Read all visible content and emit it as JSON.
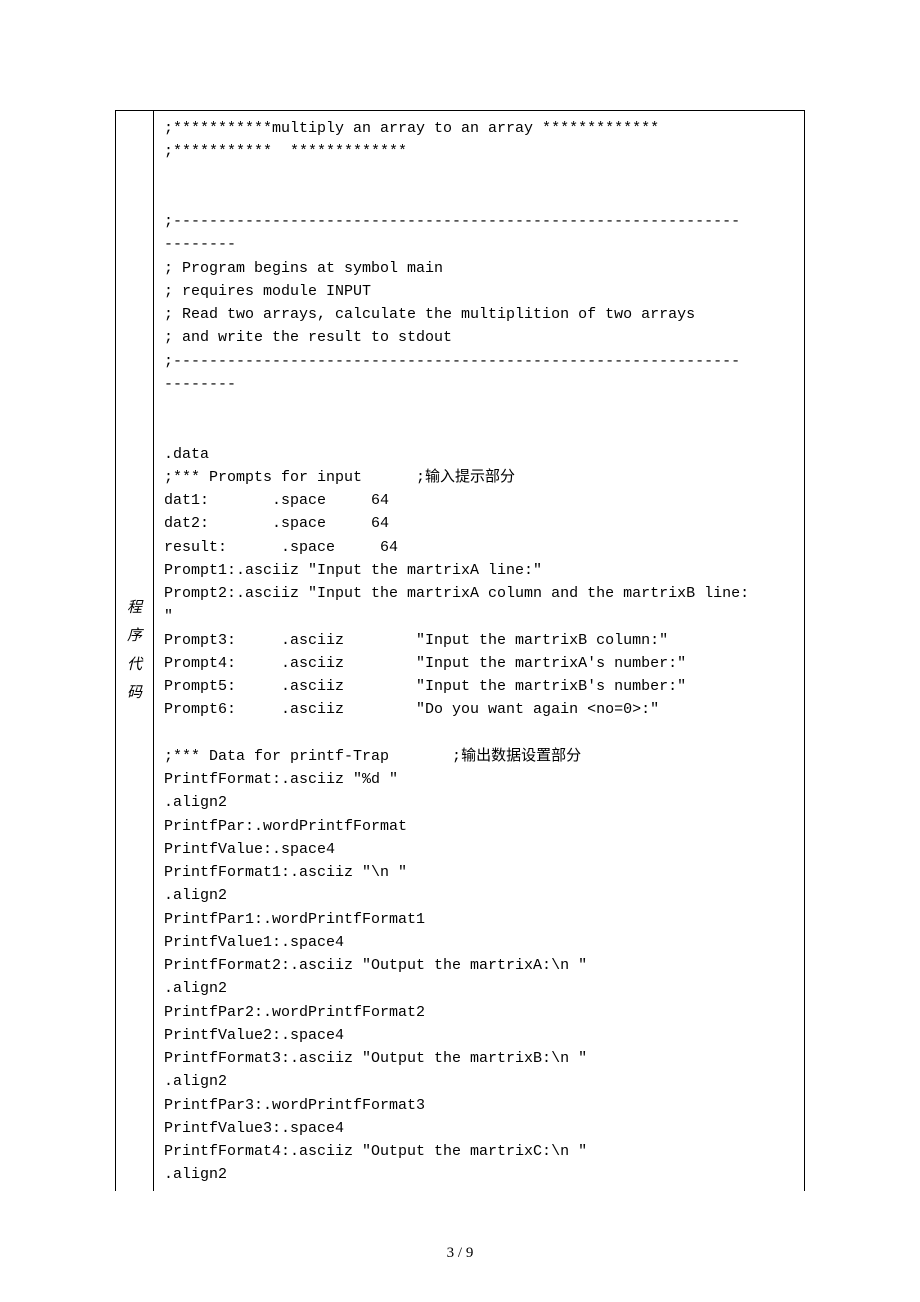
{
  "label": [
    "程",
    "序",
    "代",
    "码"
  ],
  "code_lines": [
    ";***********multiply an array to an array *************",
    ";***********  *************",
    "",
    "",
    ";---------------------------------------------------------------",
    "--------",
    "; Program begins at symbol main",
    "; requires module INPUT",
    "; Read two arrays, calculate the multiplition of two arrays",
    "; and write the result to stdout",
    ";---------------------------------------------------------------",
    "--------",
    "",
    "",
    ".data",
    ";*** Prompts for input      ;输入提示部分",
    "dat1:       .space     64",
    "dat2:       .space     64",
    "result:      .space     64",
    "Prompt1:.asciiz \"Input the martrixA line:\"",
    "Prompt2:.asciiz \"Input the martrixA column and the martrixB line:",
    "\"",
    "Prompt3:     .asciiz        \"Input the martrixB column:\"",
    "Prompt4:     .asciiz        \"Input the martrixA's number:\"",
    "Prompt5:     .asciiz        \"Input the martrixB's number:\"",
    "Prompt6:     .asciiz        \"Do you want again <no=0>:\"",
    "",
    ";*** Data for printf-Trap       ;输出数据设置部分",
    "PrintfFormat:.asciiz \"%d \"",
    ".align2",
    "PrintfPar:.wordPrintfFormat",
    "PrintfValue:.space4",
    "PrintfFormat1:.asciiz \"\\n \"",
    ".align2",
    "PrintfPar1:.wordPrintfFormat1",
    "PrintfValue1:.space4",
    "PrintfFormat2:.asciiz \"Output the martrixA:\\n \"",
    ".align2",
    "PrintfPar2:.wordPrintfFormat2",
    "PrintfValue2:.space4",
    "PrintfFormat3:.asciiz \"Output the martrixB:\\n \"",
    ".align2",
    "PrintfPar3:.wordPrintfFormat3",
    "PrintfValue3:.space4",
    "PrintfFormat4:.asciiz \"Output the martrixC:\\n \"",
    ".align2"
  ],
  "page_number": "3 / 9"
}
